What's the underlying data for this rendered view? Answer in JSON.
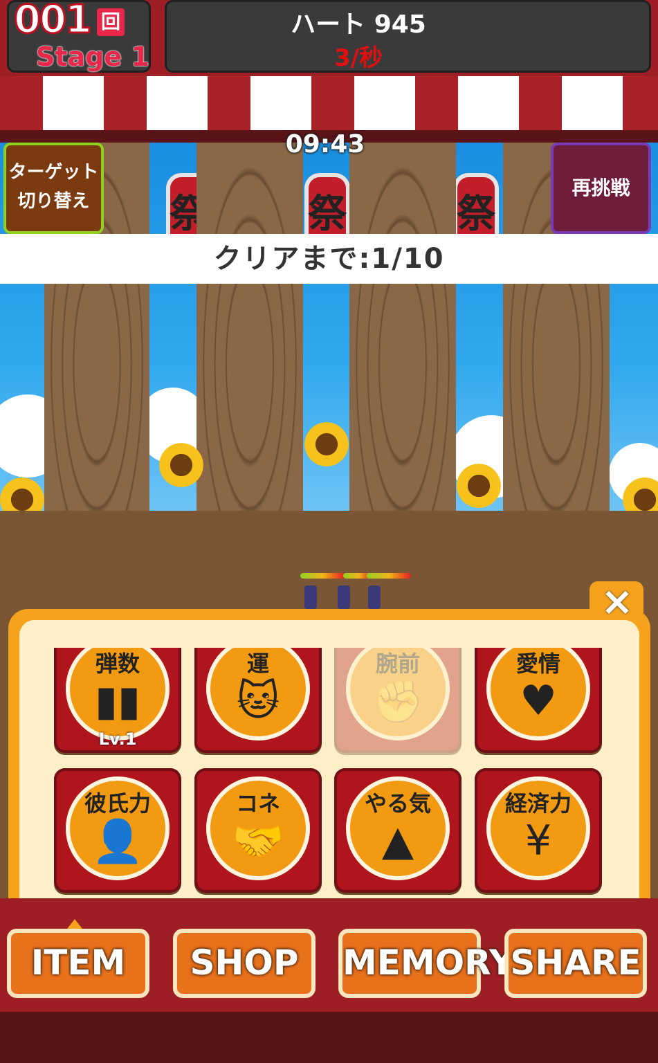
{
  "hud": {
    "play_count": "001",
    "play_count_unit": "回",
    "stage": "Stage 1",
    "hearts": "ハート 945",
    "heart_rate": "3/秒"
  },
  "timer": "09:43",
  "buttons": {
    "target_switch": [
      "ターゲット",
      "切り替え"
    ],
    "retry": "再挑戦",
    "close": "×"
  },
  "progress": "クリアまで:1/10",
  "scene": {
    "lantern_text": "祭"
  },
  "items": [
    {
      "label": "弾数",
      "icon": "bullets-icon",
      "level": "Lv.1",
      "enabled": true
    },
    {
      "label": "運",
      "icon": "lucky-cat-icon",
      "level": "",
      "enabled": true
    },
    {
      "label": "腕前",
      "icon": "arm-icon",
      "level": "",
      "enabled": false
    },
    {
      "label": "愛情",
      "icon": "heart-icon",
      "level": "",
      "enabled": true
    },
    {
      "label": "彼氏力",
      "icon": "boyfriend-icon",
      "level": "",
      "enabled": true
    },
    {
      "label": "コネ",
      "icon": "handshake-icon",
      "level": "",
      "enabled": true
    },
    {
      "label": "やる気",
      "icon": "motivation-icon",
      "level": "",
      "enabled": true
    },
    {
      "label": "経済力",
      "icon": "yen-icon",
      "level": "",
      "enabled": true
    }
  ],
  "nav": {
    "item": "ITEM",
    "shop": "SHOP",
    "memory": "MEMORY",
    "share": "SHARE"
  },
  "colors": {
    "accent_orange": "#f6a21c",
    "awning_red": "#a82227",
    "tile_red": "#b0151e"
  }
}
